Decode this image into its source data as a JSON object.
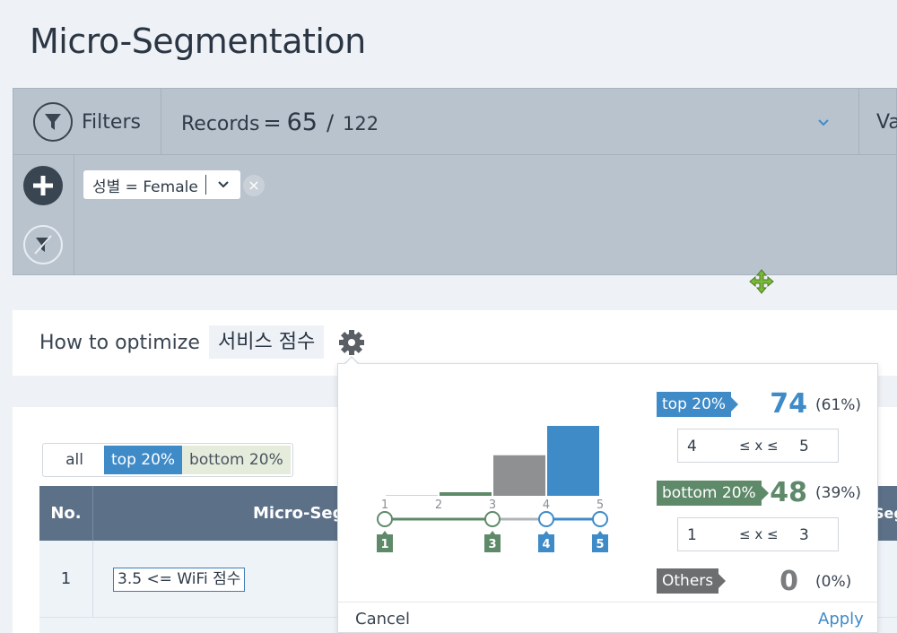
{
  "page": {
    "title": "Micro-Segmentation"
  },
  "filterbar": {
    "filters_label": "Filters",
    "records_label": "Records",
    "records_eq": "=",
    "records_count": "65",
    "records_slash": "/",
    "records_total": "122",
    "right_tab": "Va",
    "chip": {
      "text": "성별 = Female"
    },
    "chip_remove": "×"
  },
  "optimize": {
    "label": "How to optimize",
    "target": "서비스 점수"
  },
  "results": {
    "segments": [
      "all",
      "top 20%",
      "bottom 20%"
    ],
    "columns": {
      "no": "No.",
      "segment": "Micro-Segm",
      "right": "Seg"
    },
    "rows": [
      {
        "no": "1",
        "condition": "3.5 <= WiFi 점수"
      }
    ]
  },
  "popover": {
    "top": {
      "tag": "top 20%",
      "count": "74",
      "pct": "(61%)",
      "min": "4",
      "op": "≤ x ≤",
      "max": "5"
    },
    "bottom": {
      "tag": "bottom 20%",
      "count": "48",
      "pct": "(39%)",
      "min": "1",
      "op": "≤ x ≤",
      "max": "3"
    },
    "others": {
      "tag": "Others",
      "count": "0",
      "pct": "(0%)"
    },
    "cancel": "Cancel",
    "apply": "Apply",
    "histogram": {
      "ticks": [
        "1",
        "2",
        "3",
        "4",
        "5"
      ],
      "bars": [
        {
          "from": 1,
          "to": 2,
          "level": 0.0,
          "color": "#cfd4d9"
        },
        {
          "from": 2,
          "to": 3,
          "level": 0.05,
          "color": "#5f8a6a"
        },
        {
          "from": 3,
          "to": 4,
          "level": 0.58,
          "color": "#8e9092"
        },
        {
          "from": 4,
          "to": 5,
          "level": 1.0,
          "color": "#3f8bc8"
        }
      ],
      "handles": [
        {
          "value": 1,
          "label": "1",
          "color": "#5f8a6a"
        },
        {
          "value": 3,
          "label": "3",
          "color": "#5f8a6a"
        },
        {
          "value": 4,
          "label": "4",
          "color": "#3f8bc8"
        },
        {
          "value": 5,
          "label": "5",
          "color": "#3f8bc8"
        }
      ]
    }
  },
  "colors": {
    "top": "#3f8bc8",
    "bottom": "#5f8a6a",
    "others": "#6c6e70"
  }
}
